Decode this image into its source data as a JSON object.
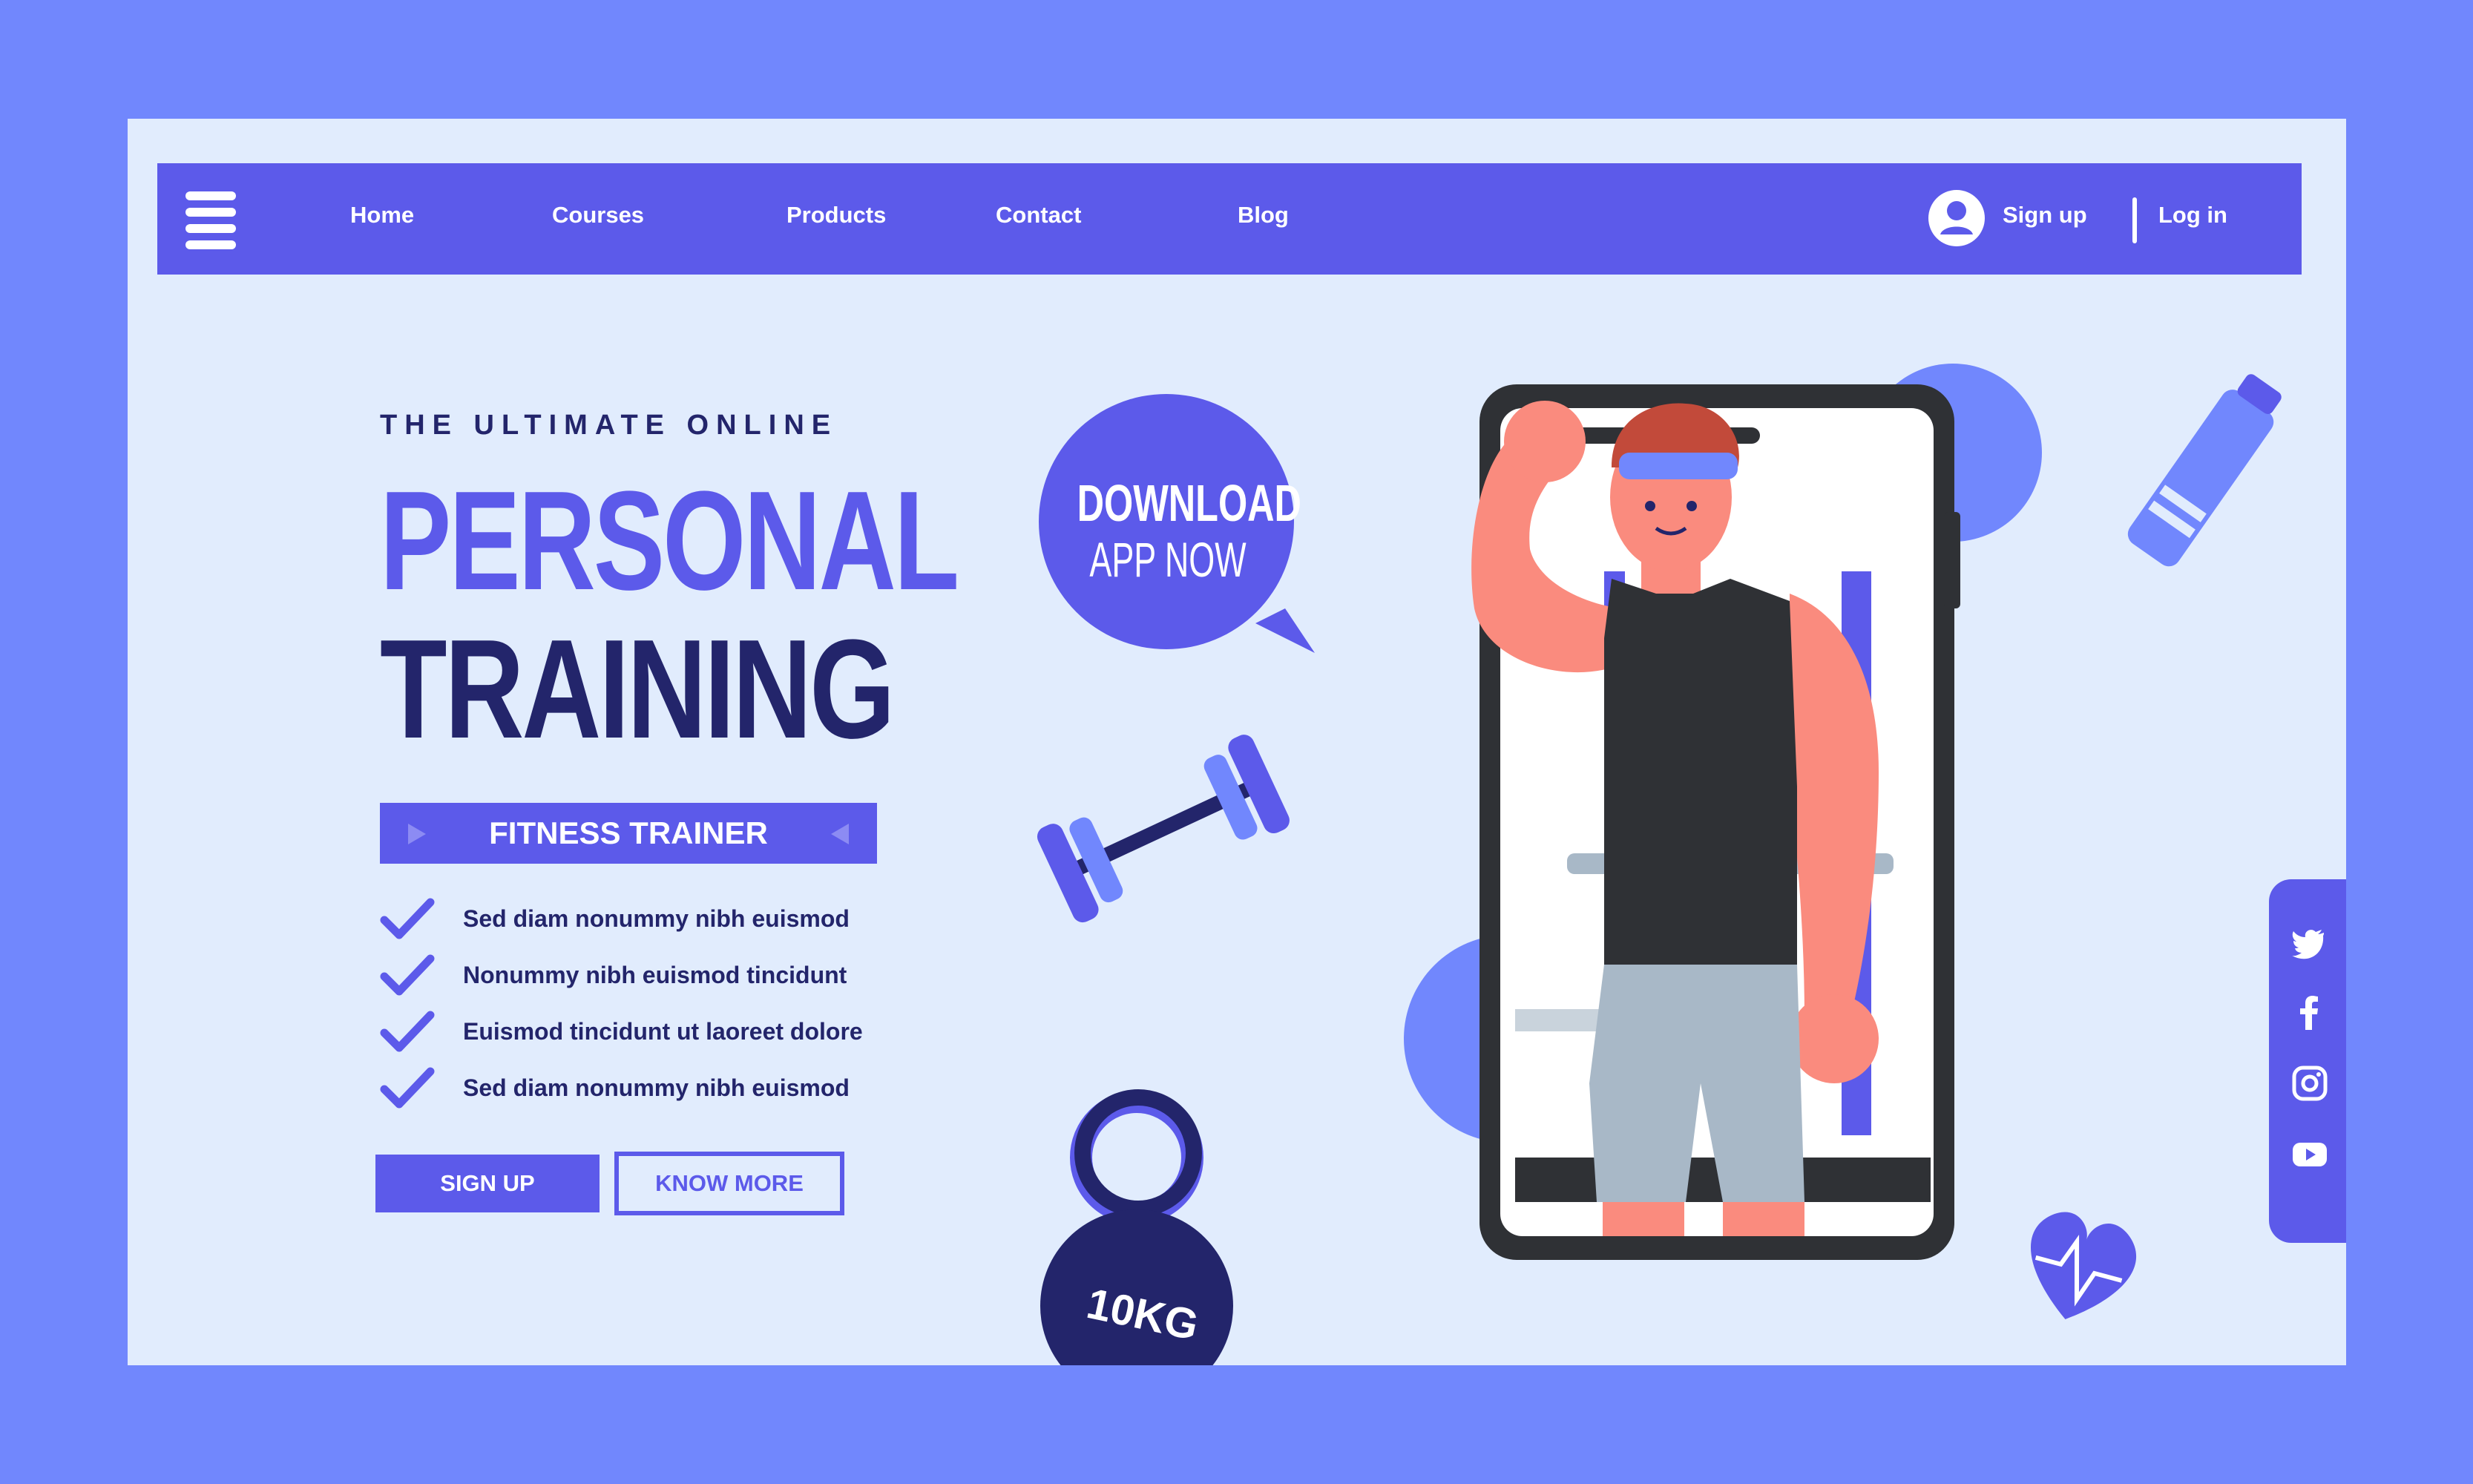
{
  "nav": {
    "links": [
      "Home",
      "Courses",
      "Products",
      "Contact",
      "Blog"
    ],
    "signup": "Sign up",
    "login": "Log in"
  },
  "hero": {
    "eyebrow": "THE ULTIMATE ONLINE",
    "title_line1": "PERSONAL",
    "title_line2": "TRAINING",
    "banner": "FITNESS TRAINER",
    "features": [
      "Sed diam nonummy nibh euismod",
      "Nonummy nibh euismod tincidunt",
      "Euismod tincidunt ut laoreet dolore",
      "Sed diam nonummy nibh euismod"
    ],
    "signup_button": "SIGN UP",
    "know_more_button": "KNOW MORE"
  },
  "download_bubble": {
    "line1": "DOWNLOAD",
    "line2": "APP NOW"
  },
  "kettlebell_label": "10KG",
  "social_icons": [
    "twitter-icon",
    "facebook-icon",
    "instagram-icon",
    "youtube-icon"
  ],
  "colors": {
    "frame": "#7187fd",
    "page_bg": "#e1ecfd",
    "primary": "#5c5aea",
    "dark_navy": "#23256b",
    "circle_accent": "#7187fd"
  }
}
